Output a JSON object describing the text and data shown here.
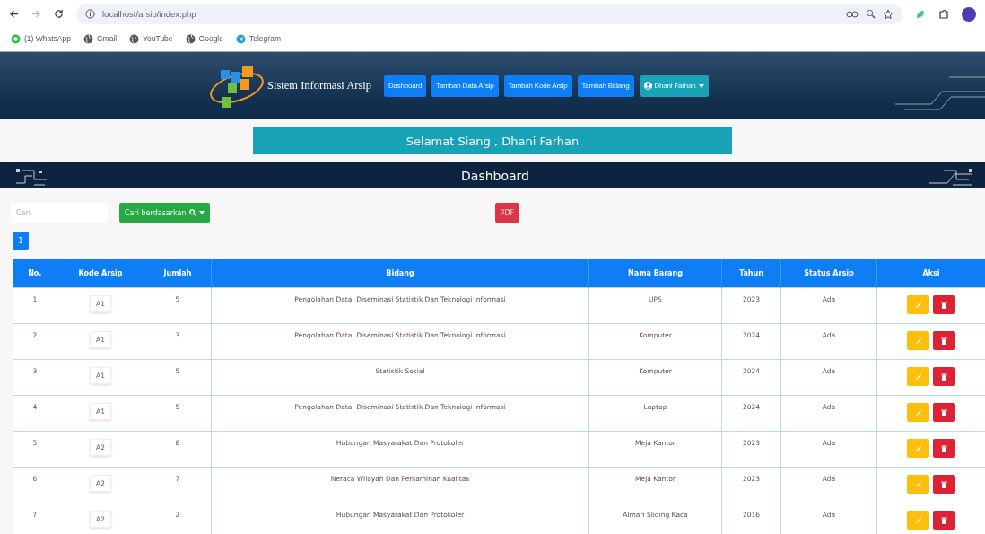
{
  "browser": {
    "url": "localhost/arsip/index.php",
    "bookmarks": [
      {
        "label": "(1) WhatsApp",
        "kind": "whatsapp"
      },
      {
        "label": "Gmail",
        "kind": "globe"
      },
      {
        "label": "YouTube",
        "kind": "globe"
      },
      {
        "label": "Google",
        "kind": "globe"
      },
      {
        "label": "Telegram",
        "kind": "telegram"
      }
    ]
  },
  "navbar": {
    "brand": "Sistem Informasi Arsip",
    "menu": [
      "Dashboard",
      "Tambah Data Arsip",
      "Tambah Kode Arsip",
      "Tambah Bidang"
    ],
    "user": "Dhani Farhan"
  },
  "greeting": "Selamat Siang , Dhani Farhan",
  "page_title": "Dashboard",
  "search": {
    "placeholder": "Cari"
  },
  "search_by_button": "Cari berdasarkan",
  "pdf_button": "PDF",
  "pagination": [
    {
      "label": "1",
      "selected": true
    }
  ],
  "table": {
    "columns": [
      "No.",
      "Kode Arsip",
      "Jumlah",
      "Bidang",
      "Nama Barang",
      "Tahun",
      "Status Arsip",
      "Aksi"
    ],
    "rows": [
      {
        "no": "1",
        "kode": "A1",
        "jumlah": "5",
        "bidang": "Pengolahan Data, Diseminasi Statistik Dan Teknologi Informasi",
        "nama_barang": "UPS",
        "tahun": "2023",
        "status": "Ada"
      },
      {
        "no": "2",
        "kode": "A1",
        "jumlah": "3",
        "bidang": "Pengolahan Data, Diseminasi Statistik Dan Teknologi Informasi",
        "nama_barang": "Komputer",
        "tahun": "2024",
        "status": "Ada"
      },
      {
        "no": "3",
        "kode": "A1",
        "jumlah": "5",
        "bidang": "Statistik Sosial",
        "nama_barang": "Komputer",
        "tahun": "2024",
        "status": "Ada"
      },
      {
        "no": "4",
        "kode": "A1",
        "jumlah": "5",
        "bidang": "Pengolahan Data, Diseminasi Statistik Dan Teknologi Informasi",
        "nama_barang": "Laptop",
        "tahun": "2024",
        "status": "Ada"
      },
      {
        "no": "5",
        "kode": "A2",
        "jumlah": "8",
        "bidang": "Hubungan Masyarakat Dan Protokoler",
        "nama_barang": "Meja Kantor",
        "tahun": "2023",
        "status": "Ada"
      },
      {
        "no": "6",
        "kode": "A2",
        "jumlah": "7",
        "bidang": "Neraca Wilayah Dan Penjaminan Kualitas",
        "nama_barang": "Meja Kantor",
        "tahun": "2023",
        "status": "Ada"
      },
      {
        "no": "7",
        "kode": "A2",
        "jumlah": "2",
        "bidang": "Hubungan Masyarakat Dan Protokoler",
        "nama_barang": "Almari Sliding Kaca",
        "tahun": "2016",
        "status": "Ada"
      }
    ]
  }
}
